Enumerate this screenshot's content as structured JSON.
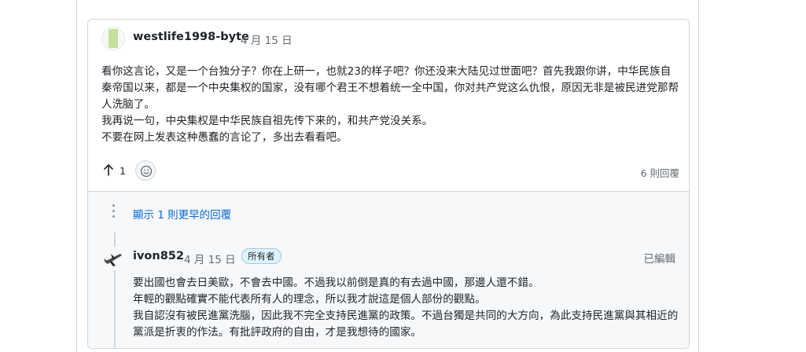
{
  "comment": {
    "author": "westlife1998-byte",
    "date": "4 月 15 日",
    "paragraphs": [
      "看你这言论，又是一个台独分子？你在上研一，也就23的样子吧？你还没来大陆见过世面吧？首先我跟你讲，中华民族自秦帝国以来，都是一个中央集权的国家，没有哪个君王不想着统一全中国，你对共产党这么仇恨，原因无非是被民进党那帮人洗脑了。",
      "我再说一句，中央集权是中华民族自祖先传下来的，和共产党没关系。",
      "不要在网上发表这种愚蠢的言论了，多出去看看吧。"
    ],
    "upvotes": "1",
    "reply_count": "6 則回覆"
  },
  "replies": {
    "show_earlier": "顯示 1 則更早的回覆",
    "reply": {
      "author": "ivon852",
      "date": "4 月 15 日",
      "badge": "所有者",
      "edited": "已編輯",
      "paragraphs": [
        "要出國也會去日美歐，不會去中國。不過我以前倒是真的有去過中國，那邊人還不錯。",
        "年輕的觀點確實不能代表所有人的理念，所以我才說這是個人部份的觀點。",
        "我自認沒有被民進黨洗腦，因此我不完全支持民進黨的政策。不過台獨是共同的大方向，為此支持民進黨與其相近的黨派是折衷的作法。有批評政府的自由，才是我想待的國家。"
      ]
    }
  },
  "colors": {
    "link": "#0969da",
    "muted": "#656d76",
    "border": "#d0d7de",
    "badge_bg": "#ddf4ff"
  }
}
